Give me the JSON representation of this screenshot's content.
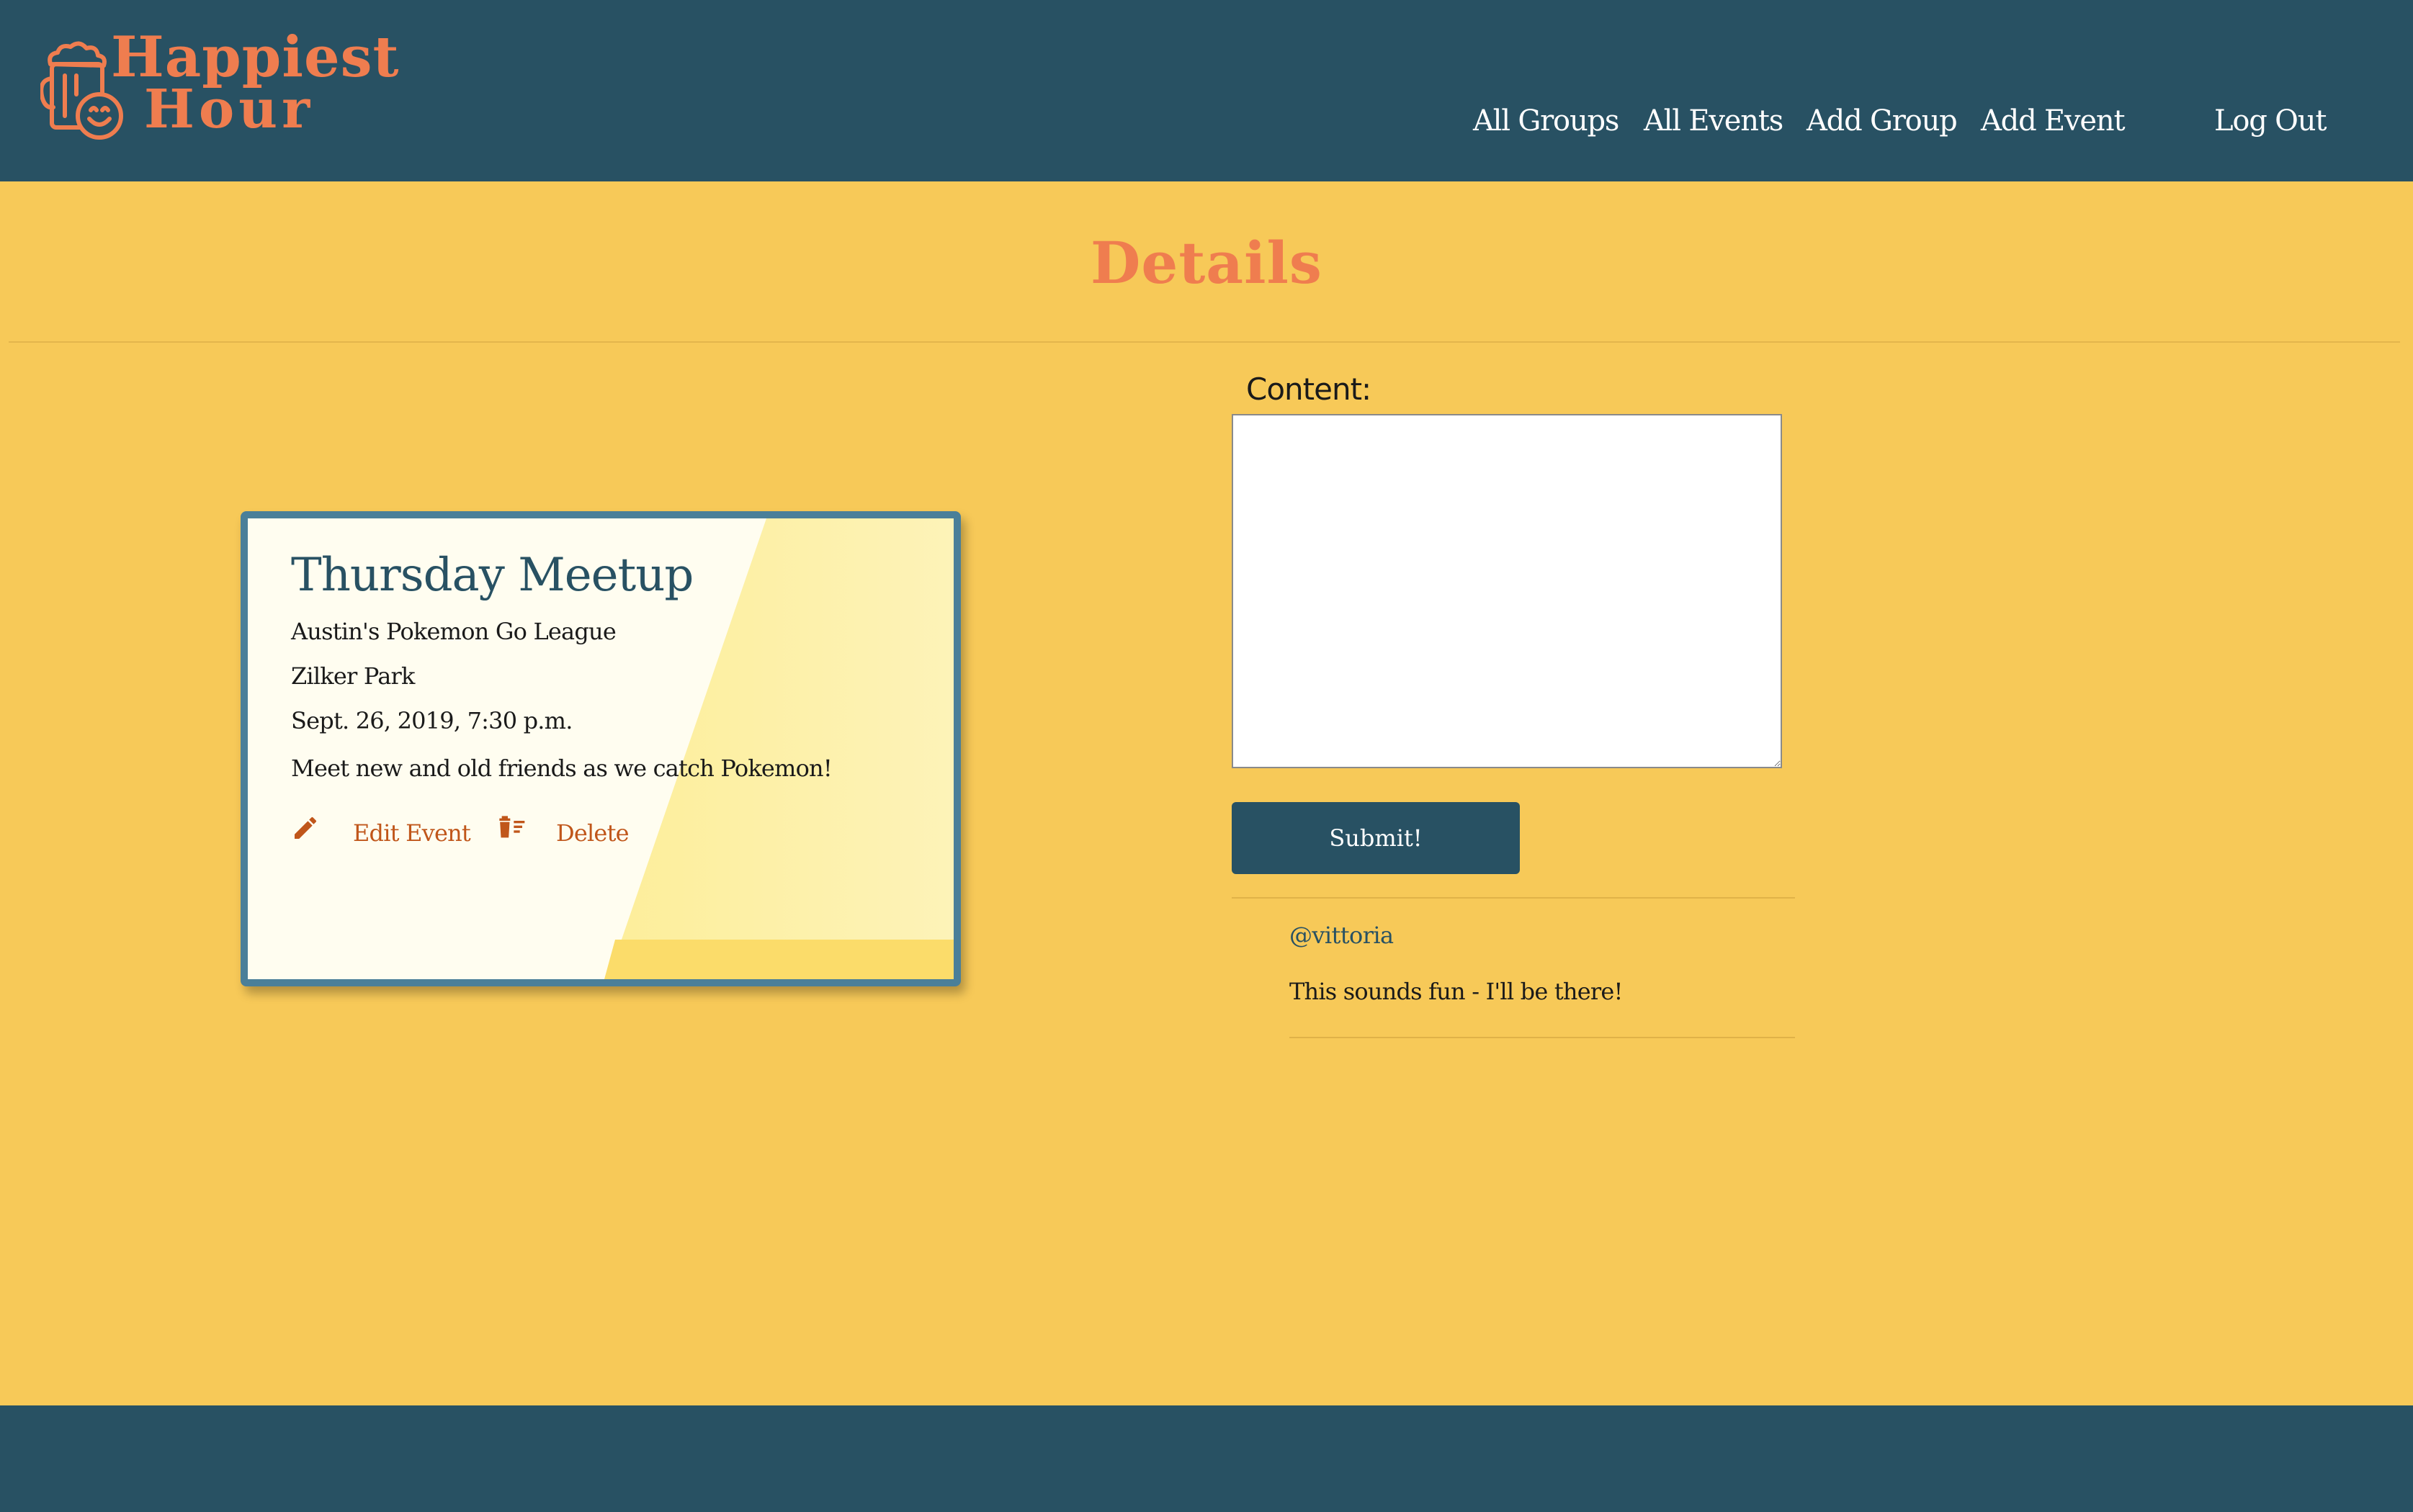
{
  "brand": {
    "line1": "Happiest",
    "line2": "Hour",
    "icon": "beer-mug-smile-icon",
    "color": "#ef7d4f"
  },
  "nav": {
    "all_groups": "All Groups",
    "all_events": "All Events",
    "add_group": "Add Group",
    "add_event": "Add Event",
    "log_out": "Log Out"
  },
  "page": {
    "title": "Details"
  },
  "event": {
    "title": "Thursday Meetup",
    "group": "Austin's Pokemon Go League",
    "location": "Zilker Park",
    "datetime": "Sept. 26, 2019, 7:30 p.m.",
    "description": "Meet new and old friends as we catch Pokemon!",
    "edit_label": "Edit Event",
    "edit_icon": "pencil-icon",
    "delete_label": "Delete",
    "delete_icon": "trash-icon"
  },
  "comment_form": {
    "label": "Content:",
    "value": "",
    "submit_label": "Submit!"
  },
  "comments": [
    {
      "author": "@vittoria",
      "text": "This sounds fun - I'll be there!"
    }
  ],
  "colors": {
    "header": "#285163",
    "background": "#f7c958",
    "accent": "#ef7d4f",
    "card_border": "#4a7f99",
    "action": "#c0561a"
  }
}
